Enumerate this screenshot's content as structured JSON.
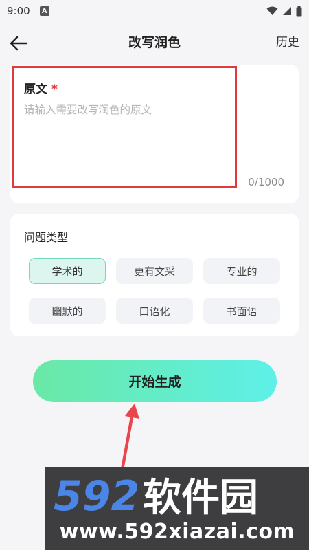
{
  "status_bar": {
    "time": "9:00",
    "notification_glyph": "A"
  },
  "header": {
    "title": "改写润色",
    "history_label": "历史",
    "back_icon": "arrow-left-icon"
  },
  "original_text": {
    "label": "原文",
    "required_mark": "*",
    "placeholder": "请输入需要改写润色的原文",
    "value": "",
    "char_count": "0/1000"
  },
  "question_type": {
    "title": "问题类型",
    "options": [
      {
        "label": "学术的",
        "selected": true
      },
      {
        "label": "更有文采",
        "selected": false
      },
      {
        "label": "专业的",
        "selected": false
      },
      {
        "label": "幽默的",
        "selected": false
      },
      {
        "label": "口语化",
        "selected": false
      },
      {
        "label": "书面语",
        "selected": false
      }
    ]
  },
  "generate_button": {
    "label": "开始生成"
  },
  "annotation": {
    "highlight_color": "#e0393e",
    "arrow_color": "#e8464c"
  },
  "watermark": {
    "logo_text": "592软件园",
    "url": "www.592xiazai.com"
  },
  "colors": {
    "accent_start": "#6ae8a6",
    "accent_end": "#5ef0e8",
    "selected_chip_bg": "#dcf6ef",
    "required": "#e8333a"
  }
}
